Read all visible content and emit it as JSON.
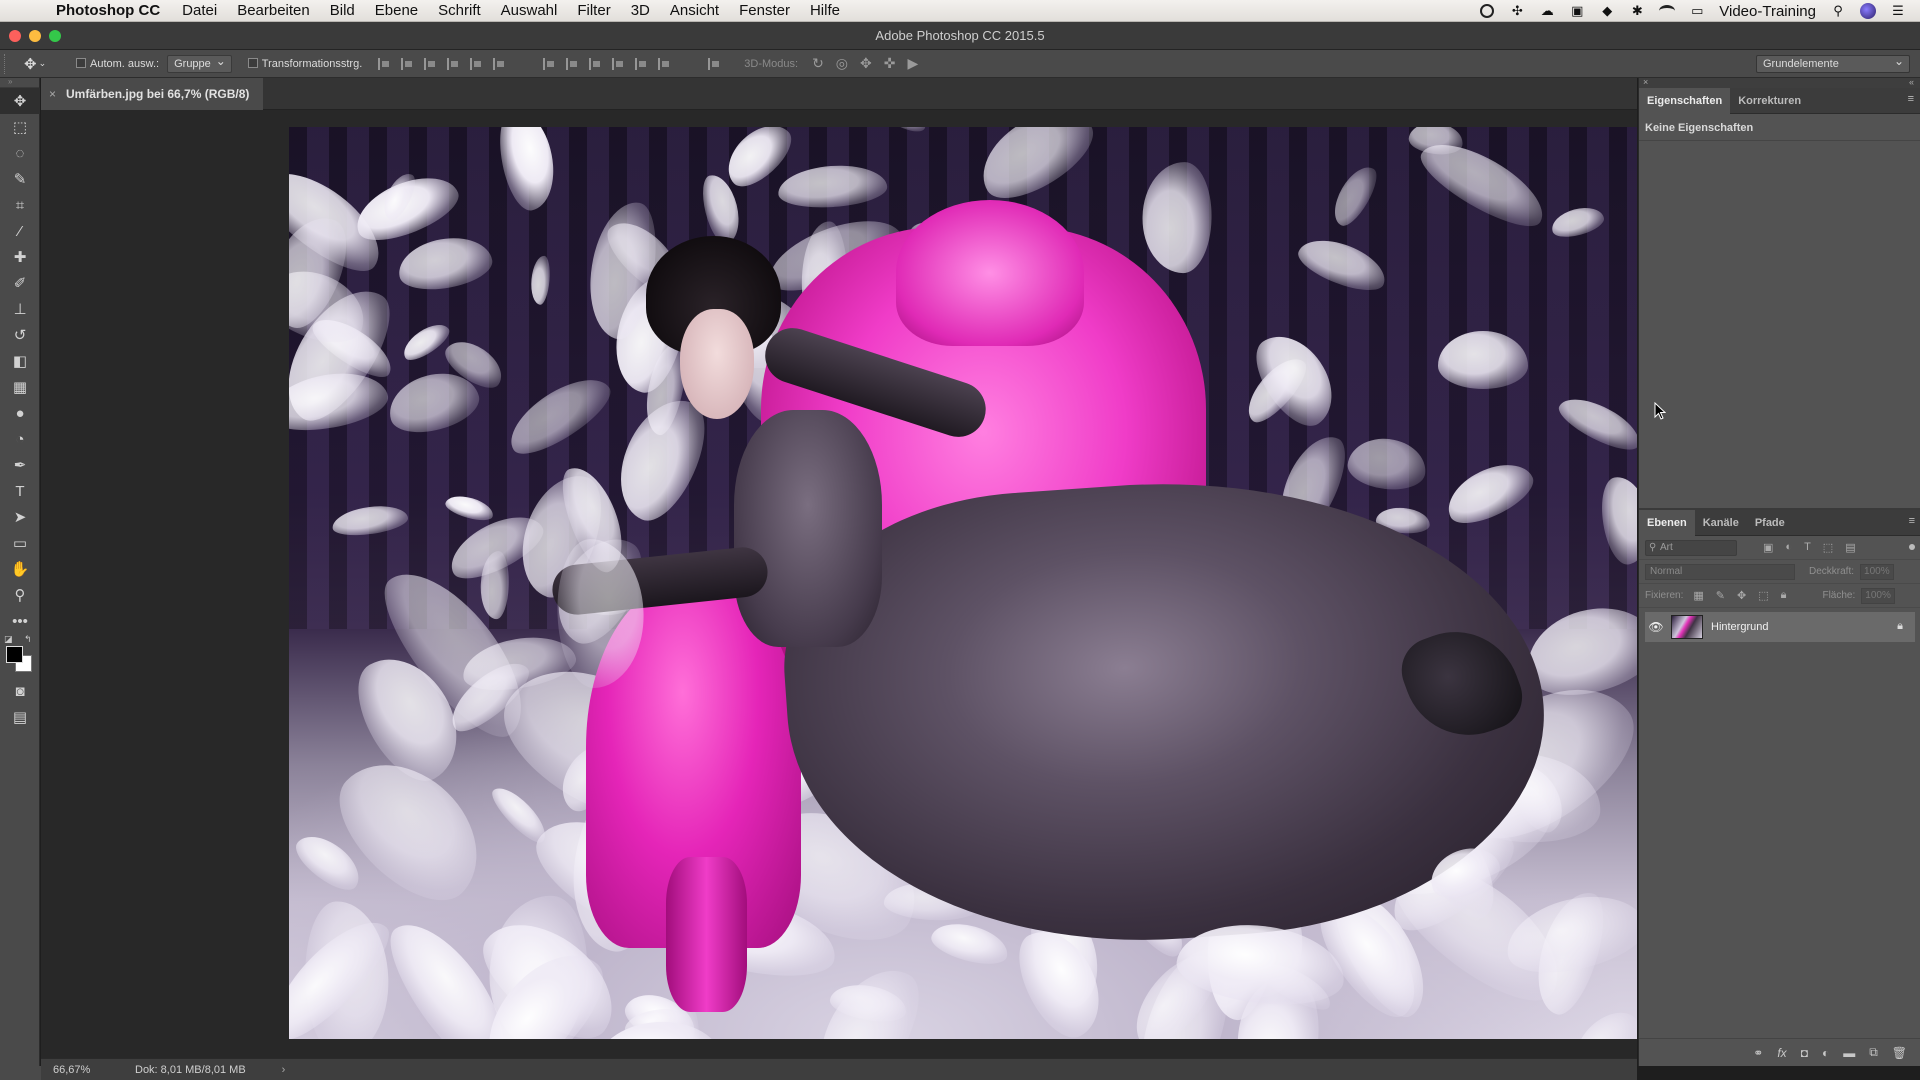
{
  "menubar": {
    "apple": "",
    "app_name": "Photoshop CC",
    "items": [
      "Datei",
      "Bearbeiten",
      "Bild",
      "Ebene",
      "Schrift",
      "Auswahl",
      "Filter",
      "3D",
      "Ansicht",
      "Fenster",
      "Hilfe"
    ],
    "user": "Video-Training"
  },
  "window": {
    "title": "Adobe Photoshop CC 2015.5",
    "traffic_colors": [
      "#fc605c",
      "#fdbc40",
      "#34c84a"
    ]
  },
  "options": {
    "auto_select_label": "Autom. ausw.:",
    "auto_select_value": "Gruppe",
    "transform_label": "Transformationsstrg.",
    "mode_3d_label": "3D-Modus:",
    "workspace": "Grundelemente"
  },
  "tools": [
    {
      "name": "move-tool",
      "glyph": "✥"
    },
    {
      "name": "marquee-tool",
      "glyph": "⬚"
    },
    {
      "name": "lasso-tool",
      "glyph": "◌"
    },
    {
      "name": "quick-select-tool",
      "glyph": "✎"
    },
    {
      "name": "crop-tool",
      "glyph": "⌗"
    },
    {
      "name": "eyedropper-tool",
      "glyph": "⁄"
    },
    {
      "name": "healing-tool",
      "glyph": "✚"
    },
    {
      "name": "brush-tool",
      "glyph": "✐"
    },
    {
      "name": "stamp-tool",
      "glyph": "⊥"
    },
    {
      "name": "history-brush-tool",
      "glyph": "↺"
    },
    {
      "name": "eraser-tool",
      "glyph": "◧"
    },
    {
      "name": "gradient-tool",
      "glyph": "▦"
    },
    {
      "name": "blur-tool",
      "glyph": "●"
    },
    {
      "name": "dodge-tool",
      "glyph": "◔"
    },
    {
      "name": "pen-tool",
      "glyph": "✒"
    },
    {
      "name": "type-tool",
      "glyph": "T"
    },
    {
      "name": "path-select-tool",
      "glyph": "➤"
    },
    {
      "name": "rectangle-tool",
      "glyph": "▭"
    },
    {
      "name": "hand-tool",
      "glyph": "✋"
    },
    {
      "name": "zoom-tool",
      "glyph": "⚲"
    },
    {
      "name": "more-tools",
      "glyph": "•••"
    }
  ],
  "document": {
    "tab_title": "Umfärben.jpg bei 66,7% (RGB/8)",
    "close_glyph": "×"
  },
  "status": {
    "zoom": "66,67%",
    "doc_info": "Dok: 8,01 MB/8,01 MB",
    "arrow": "›"
  },
  "properties_panel": {
    "tabs": [
      "Eigenschaften",
      "Korrekturen"
    ],
    "empty_text": "Keine Eigenschaften"
  },
  "layers_panel": {
    "tabs": [
      "Ebenen",
      "Kanäle",
      "Pfade"
    ],
    "filter_placeholder": "Art",
    "blend_mode": "Normal",
    "opacity_label": "Deckkraft:",
    "opacity_value": "100%",
    "lock_label": "Fixieren:",
    "fill_label": "Fläche:",
    "fill_value": "100%",
    "layers": [
      {
        "name": "Hintergrund",
        "visible": true,
        "locked": true
      }
    ],
    "footer_icons": [
      "link-icon",
      "fx-icon",
      "mask-icon",
      "adjustment-icon",
      "folder-icon",
      "new-layer-icon",
      "trash-icon"
    ]
  }
}
